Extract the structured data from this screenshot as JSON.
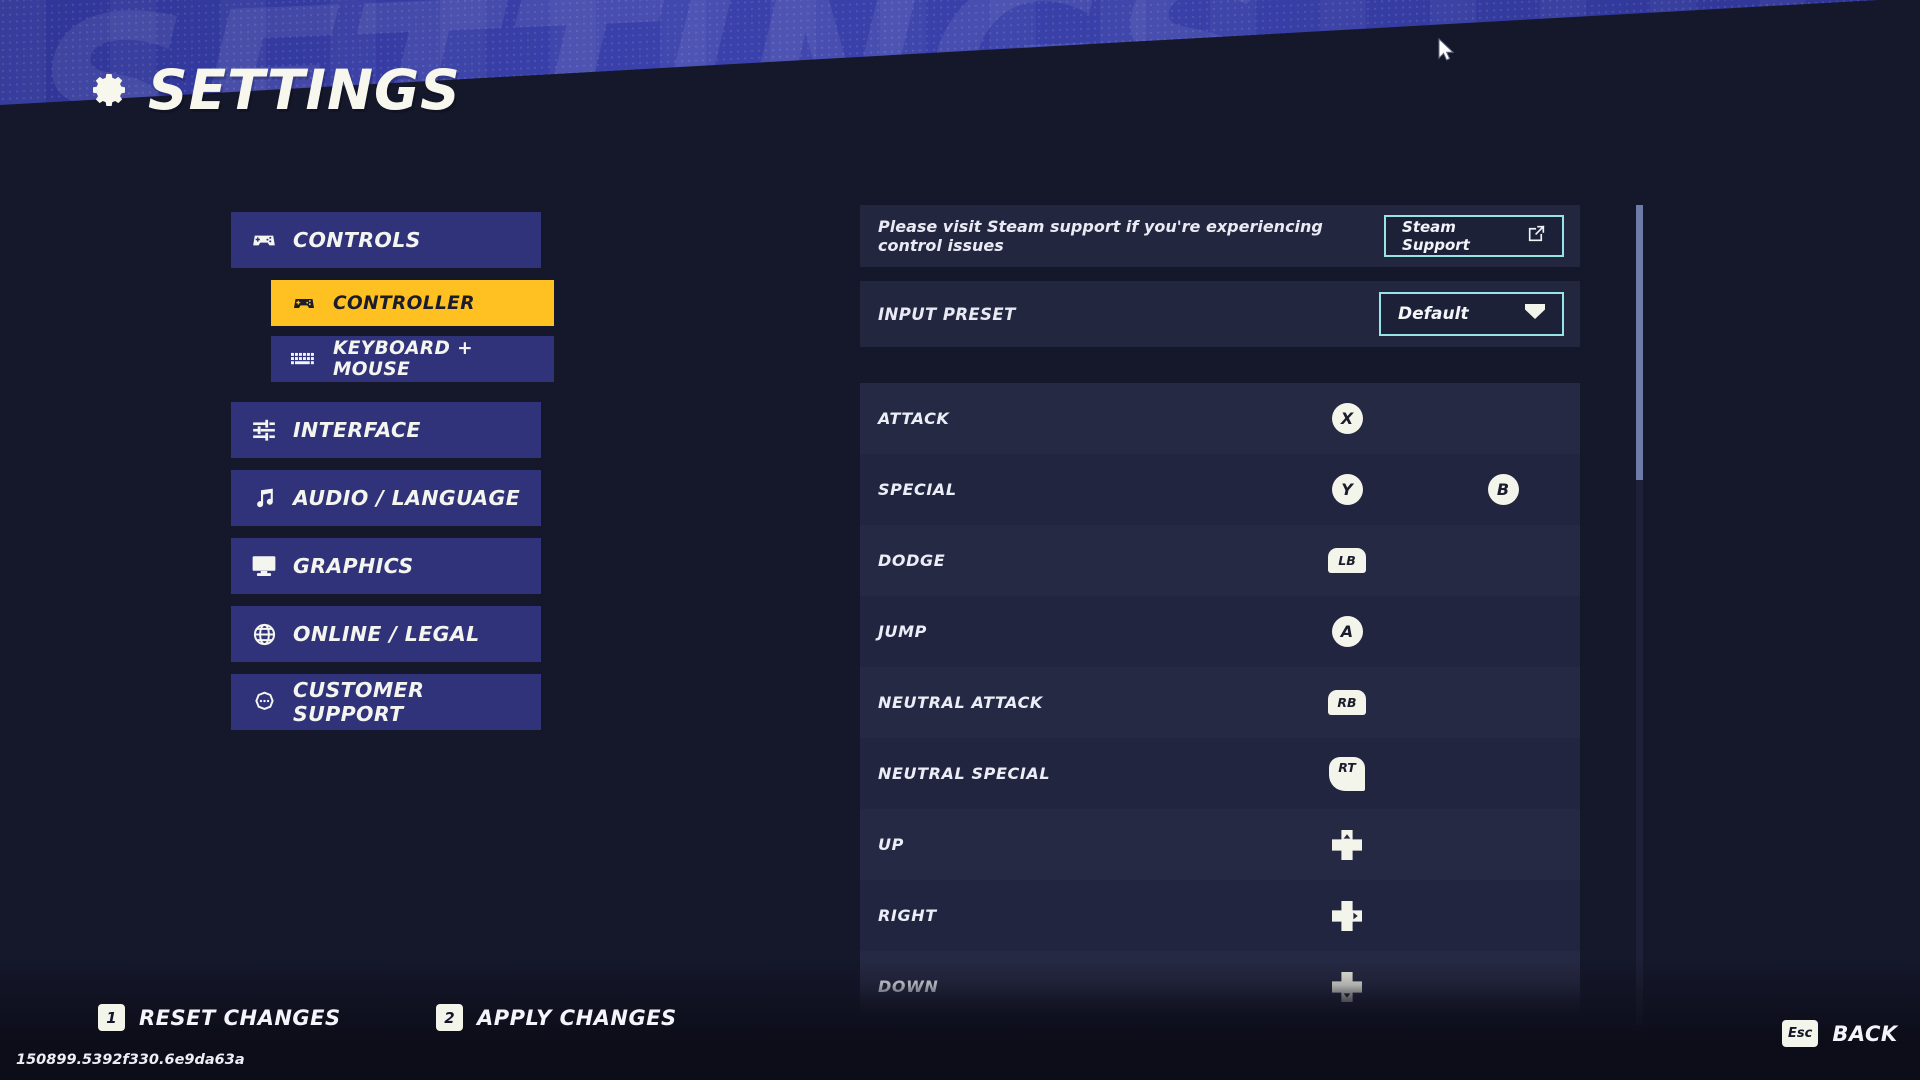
{
  "header": {
    "title": "SETTINGS",
    "ghost_title": "SETTINGS",
    "gear_icon": "gear-icon",
    "accent_blue": "#3940a8"
  },
  "sidebar": {
    "items": [
      {
        "label": "CONTROLS",
        "icon": "gamepad-icon",
        "active": false,
        "sub": false
      },
      {
        "label": "CONTROLLER",
        "icon": "gamepad-icon",
        "active": true,
        "sub": true
      },
      {
        "label": "KEYBOARD + MOUSE",
        "icon": "keyboard-icon",
        "active": false,
        "sub": true
      },
      {
        "label": "INTERFACE",
        "icon": "sliders-icon",
        "active": false,
        "sub": false
      },
      {
        "label": "AUDIO / LANGUAGE",
        "icon": "music-note-icon",
        "active": false,
        "sub": false
      },
      {
        "label": "GRAPHICS",
        "icon": "monitor-icon",
        "active": false,
        "sub": false
      },
      {
        "label": "ONLINE / LEGAL",
        "icon": "globe-icon",
        "active": false,
        "sub": false
      },
      {
        "label": "CUSTOMER SUPPORT",
        "icon": "speech-bubble-icon",
        "active": false,
        "sub": false
      }
    ],
    "highlight_color": "#ffc022",
    "item_color": "#30337a"
  },
  "main": {
    "support_notice": {
      "text": "Please visit Steam support if you're experiencing control issues",
      "button_label": "Steam Support",
      "button_icon": "external-link-icon",
      "border_color": "#97e4e4"
    },
    "input_preset": {
      "label": "INPUT PRESET",
      "value": "Default",
      "dropdown_icon": "chevron-down-icon"
    },
    "bindings": [
      {
        "action": "ATTACK",
        "glyphs": [
          {
            "type": "face",
            "label": "X"
          }
        ]
      },
      {
        "action": "SPECIAL",
        "glyphs": [
          {
            "type": "face",
            "label": "Y"
          },
          {
            "type": "face",
            "label": "B"
          }
        ]
      },
      {
        "action": "DODGE",
        "glyphs": [
          {
            "type": "bumper",
            "label": "LB"
          }
        ]
      },
      {
        "action": "JUMP",
        "glyphs": [
          {
            "type": "face",
            "label": "A"
          }
        ]
      },
      {
        "action": "NEUTRAL ATTACK",
        "glyphs": [
          {
            "type": "bumper",
            "label": "RB"
          }
        ]
      },
      {
        "action": "NEUTRAL SPECIAL",
        "glyphs": [
          {
            "type": "trigger",
            "label": "RT"
          }
        ]
      },
      {
        "action": "UP",
        "glyphs": [
          {
            "type": "dpad",
            "label": "up"
          }
        ]
      },
      {
        "action": "RIGHT",
        "glyphs": [
          {
            "type": "dpad",
            "label": "right"
          }
        ]
      },
      {
        "action": "DOWN",
        "glyphs": [
          {
            "type": "dpad",
            "label": "down"
          }
        ]
      }
    ]
  },
  "footer": {
    "reset": {
      "key": "1",
      "label": "RESET CHANGES"
    },
    "apply": {
      "key": "2",
      "label": "APPLY CHANGES"
    },
    "back": {
      "key": "Esc",
      "label": "BACK"
    },
    "build_version": "150899.5392f330.6e9da63a"
  }
}
